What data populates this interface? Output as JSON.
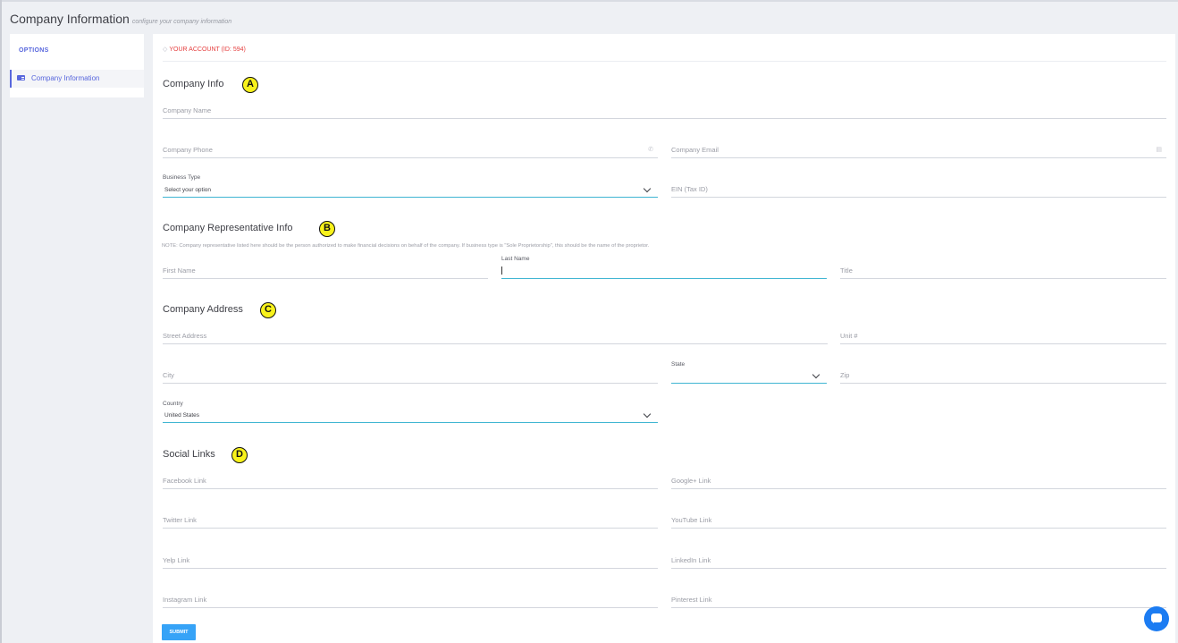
{
  "header": {
    "title": "Company Information",
    "subtitle": "configure your company information"
  },
  "sidebar": {
    "heading": "OPTIONS",
    "items": [
      {
        "label": "Company Information",
        "icon": "id-card-icon",
        "active": true
      }
    ]
  },
  "account": {
    "label": "YOUR ACCOUNT (ID: 594)",
    "icon": "tag-icon"
  },
  "sections": {
    "company_info": {
      "title": "Company Info",
      "marker": "A",
      "company_name": "Company Name",
      "company_phone": "Company Phone",
      "company_email": "Company Email",
      "business_type_label": "Business Type",
      "business_type_value": "Select your option",
      "ein": "EIN (Tax ID)"
    },
    "representative": {
      "title": "Company Representative Info",
      "marker": "B",
      "note": "NOTE: Company representative listed here should be the person authorized to make financial decisions on behalf of the company. If business type is \"Sole Proprietorship\", this should be the name of the proprietor.",
      "first_name": "First Name",
      "last_name_label": "Last Name",
      "title_field": "Title"
    },
    "address": {
      "title": "Company Address",
      "marker": "C",
      "street": "Street Address",
      "unit": "Unit #",
      "city": "City",
      "state_label": "State",
      "state_value": "",
      "zip": "Zip",
      "country_label": "Country",
      "country_value": "United States"
    },
    "social": {
      "title": "Social Links",
      "marker": "D",
      "facebook": "Facebook Link",
      "googleplus": "Google+ Link",
      "twitter": "Twitter Link",
      "youtube": "YouTube Link",
      "yelp": "Yelp Link",
      "linkedin": "LinkedIn Link",
      "instagram": "Instagram Link",
      "pinterest": "Pinterest Link"
    }
  },
  "actions": {
    "submit": "SUBMIT"
  },
  "chat": {
    "icon": "chat-bubble-icon"
  },
  "colors": {
    "accent": "#5867dd",
    "focus": "#3fb5d2",
    "danger": "#e53f3f",
    "submit": "#36a3f7",
    "chat": "#1c7cf2",
    "marker": "#f8f21b"
  }
}
